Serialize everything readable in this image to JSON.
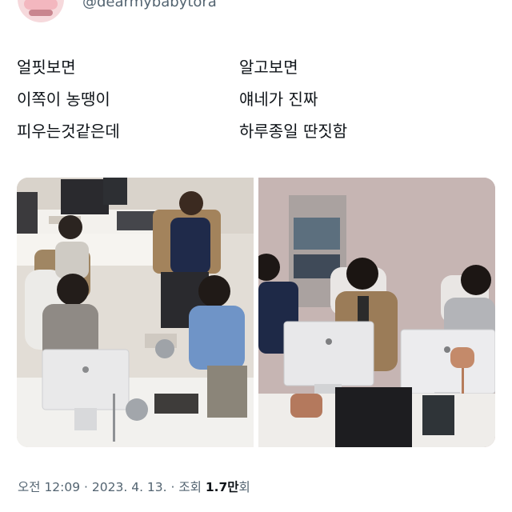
{
  "tweet": {
    "handle": "@dearmybabytora",
    "left_lines": [
      "얼핏보면",
      "이쪽이 농땡이",
      "피우는것같은데"
    ],
    "right_lines": [
      "알고보면",
      "얘네가 진짜",
      "하루종일 딴짓함"
    ]
  },
  "meta": {
    "time": "오전 12:09",
    "sep1": " · ",
    "date": "2023. 4. 13.",
    "sep2": " · ",
    "views_label": "조회 ",
    "views_value": "1.7만",
    "views_suffix": "회"
  },
  "icons": {
    "avatar": "profile-avatar-icon"
  },
  "colors": {
    "secondary_text": "#536471",
    "text": "#0f1419"
  }
}
